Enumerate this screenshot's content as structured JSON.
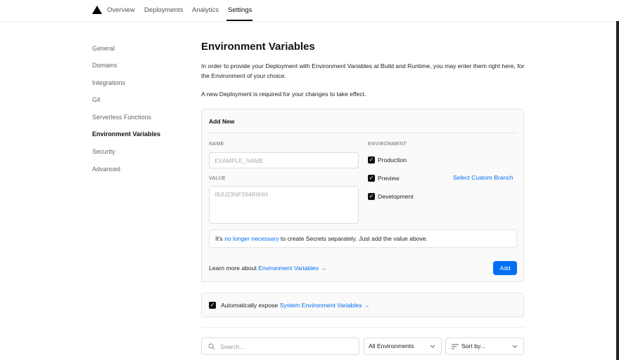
{
  "nav": {
    "tabs": [
      "Overview",
      "Deployments",
      "Analytics",
      "Settings"
    ],
    "active_tab": "Settings"
  },
  "sidebar": {
    "items": [
      "General",
      "Domains",
      "Integrations",
      "Git",
      "Serverless Functions",
      "Environment Variables",
      "Security",
      "Advanced"
    ],
    "active_item": "Environment Variables"
  },
  "main": {
    "title": "Environment Variables",
    "intro": "In order to provide your Deployment with Environment Variables at Build and Runtime, you may enter them right here, for the Environment of your choice.",
    "note": "A new Deployment is required for your changes to take effect."
  },
  "add_new": {
    "title": "Add New",
    "name_label": "NAME",
    "name_placeholder": "EXAMPLE_NAME",
    "value_label": "VALUE",
    "value_placeholder": "I9JU23NF394R6HH",
    "environment_label": "ENVIRONMENT",
    "environments": [
      {
        "label": "Production",
        "checked": true
      },
      {
        "label": "Preview",
        "checked": true
      },
      {
        "label": "Development",
        "checked": true
      }
    ],
    "custom_branch_link": "Select Custom Branch",
    "secrets_prefix": "It's ",
    "secrets_link": "no longer necessary",
    "secrets_suffix": " to create Secrets separately. Just add the value above.",
    "learn_prefix": "Learn more about ",
    "learn_link": "Environment Variables →",
    "add_button": "Add"
  },
  "expose": {
    "checked": true,
    "label_prefix": "Automatically expose ",
    "label_link": "System Environment Variables →"
  },
  "filters": {
    "search_placeholder": "Search...",
    "environment_select": "All Environments",
    "sort_select": "Sort by..."
  },
  "colors": {
    "link": "#0070f3",
    "primary_button": "#0070f3",
    "checkbox": "#111111"
  },
  "icons": [
    "vercel-logo",
    "check-icon",
    "search-icon",
    "chevron-down-icon",
    "sort-lines-icon"
  ]
}
